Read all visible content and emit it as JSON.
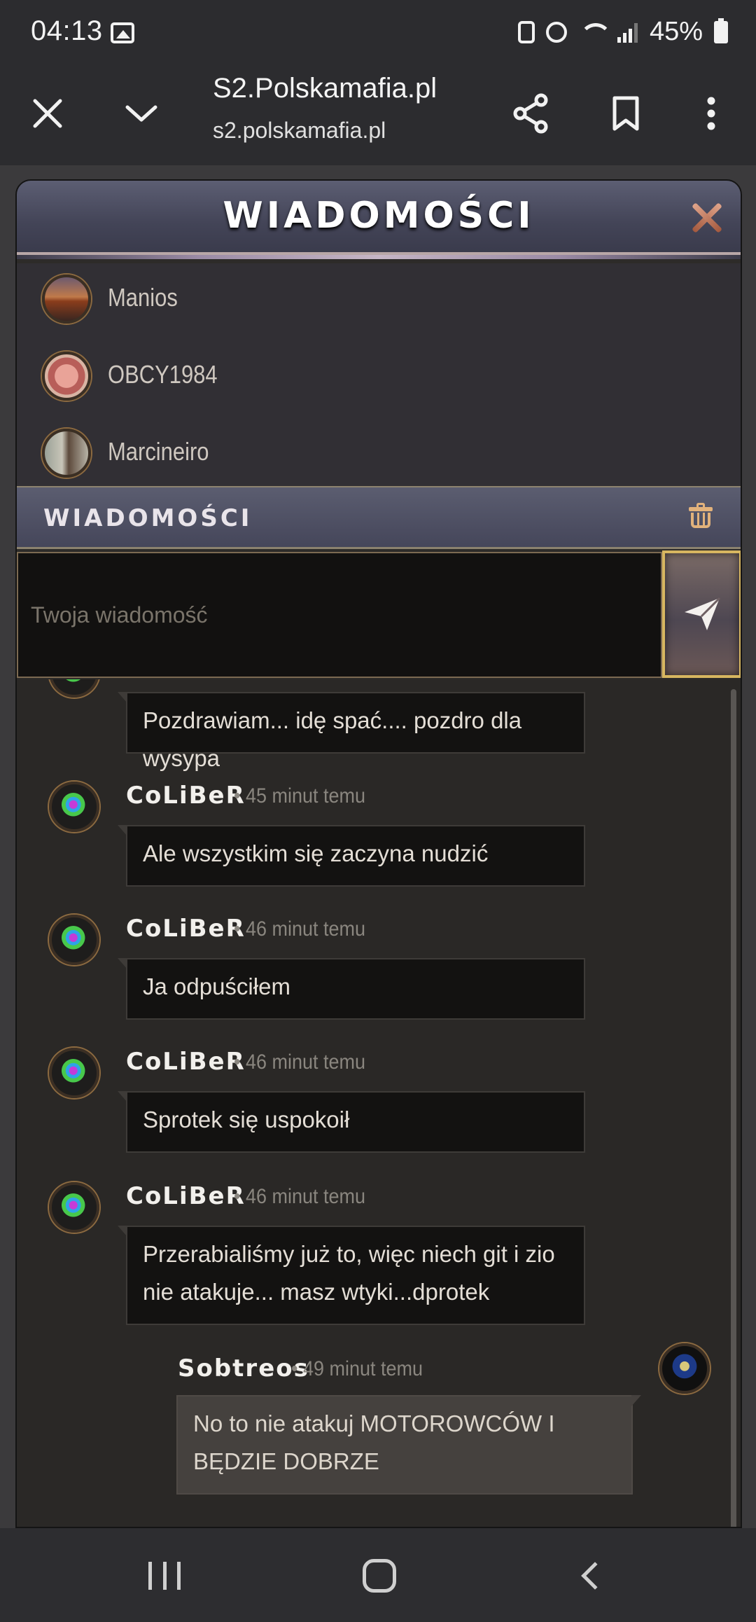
{
  "status_bar": {
    "time": "04:13",
    "battery": "45%",
    "icons": [
      "gallery-icon",
      "nfc-icon",
      "alarm-icon",
      "wifi-icon",
      "signal-icon",
      "battery-icon"
    ]
  },
  "browser": {
    "title": "S2.Polskamafia.pl",
    "url": "s2.polskamafia.pl",
    "icons": [
      "close-icon",
      "chevron-down-icon",
      "share-icon",
      "bookmark-icon",
      "more-vert-icon"
    ]
  },
  "modal": {
    "title": "WIADOMOŚCI",
    "contacts": [
      {
        "name": "Manios"
      },
      {
        "name": "OBCY1984"
      },
      {
        "name": "Marcineiro"
      }
    ],
    "section_title": "WIADOMOŚCI",
    "composer": {
      "placeholder": "Twoja wiadomość",
      "value": ""
    }
  },
  "messages": [
    {
      "author": "",
      "time": "",
      "text": "Pozdrawiam... idę spać.... pozdro dla wysypa"
    },
    {
      "author": "CoLiBeR",
      "time": "• 45 minut temu",
      "text": "Ale wszystkim się zaczyna nudzić"
    },
    {
      "author": "CoLiBeR",
      "time": "• 46 minut temu",
      "text": "Ja odpuściłem"
    },
    {
      "author": "CoLiBeR",
      "time": "• 46 minut temu",
      "text": "Sprotek się uspokoił"
    },
    {
      "author": "CoLiBeR",
      "time": "• 46 minut temu",
      "text": "Przerabialiśmy już to, więc niech git i zio nie atakuje... masz wtyki...dprotek"
    },
    {
      "author": "Sobtreos",
      "time": "• 49 minut temu",
      "text": "No to nie atakuj MOTOROWCÓW I BĘDZIE DOBRZE"
    }
  ],
  "colors": {
    "accent_gold": "#d7b660",
    "close_x": "#c8775a",
    "trash": "#e2b27b"
  }
}
